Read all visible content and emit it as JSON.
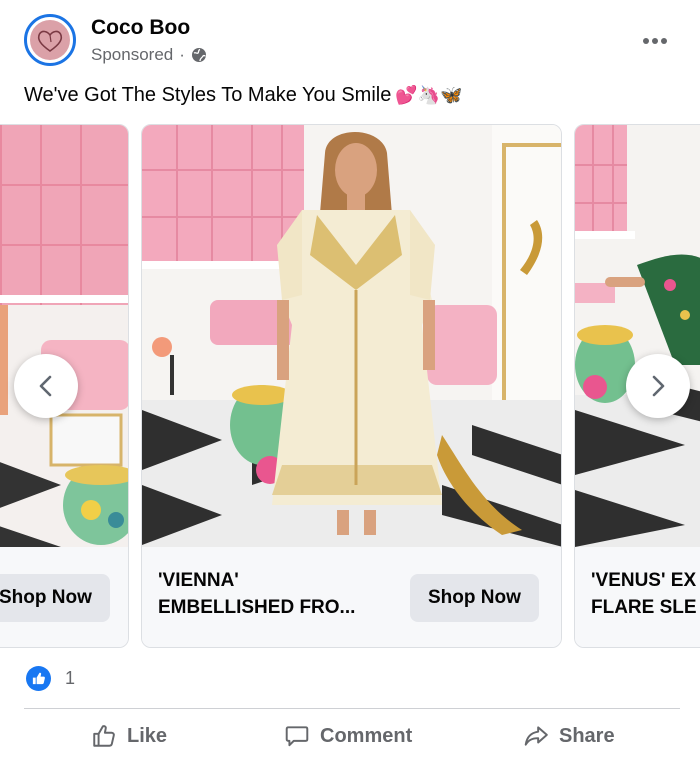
{
  "header": {
    "page_name": "Coco Boo",
    "sponsored_label": "Sponsored",
    "separator": "·",
    "avatar_icon": "heart-logo-icon",
    "privacy_icon": "globe-icon",
    "menu_icon": "more-dots-icon"
  },
  "post": {
    "text": "We've Got The Styles To Make You Smile",
    "emojis": "💕🦄🦋"
  },
  "carousel": {
    "cards": [
      {
        "title_line1": "",
        "title_line2": "",
        "button_label": "Shop Now"
      },
      {
        "title_line1": "'VIENNA'",
        "title_line2": "EMBELLISHED FRO...",
        "button_label": "Shop Now"
      },
      {
        "title_line1": "'VENUS' EX",
        "title_line2": "FLARE SLE",
        "button_label": ""
      }
    ],
    "prev_icon": "chevron-left-icon",
    "next_icon": "chevron-right-icon"
  },
  "reactions": {
    "icon": "thumbs-up-icon",
    "count": "1"
  },
  "actions": {
    "like_label": "Like",
    "comment_label": "Comment",
    "share_label": "Share"
  },
  "colors": {
    "brand_blue": "#1877f2",
    "secondary_text": "#65676b",
    "button_bg": "#e4e6eb",
    "card_bg": "#f7f8fa"
  }
}
